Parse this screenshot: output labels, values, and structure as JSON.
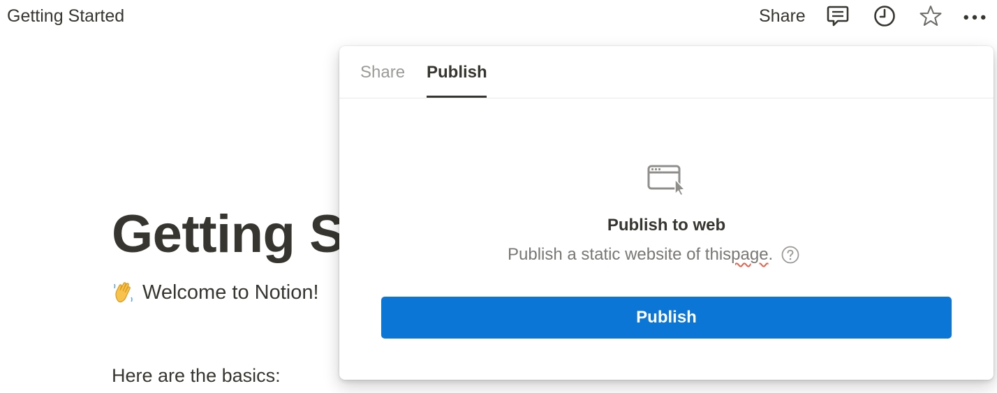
{
  "topbar": {
    "breadcrumb": "Getting Started",
    "share_label": "Share",
    "icons": [
      "comment-icon",
      "clock-icon",
      "star-icon",
      "more-icon"
    ]
  },
  "page": {
    "title": "Getting S",
    "welcome": "Welcome to Notion!",
    "welcome_icon": "waving-hand-emoji",
    "basics": "Here are the basics:"
  },
  "popover": {
    "tabs": [
      {
        "label": "Share",
        "active": false
      },
      {
        "label": "Publish",
        "active": true
      }
    ],
    "icon": "browser-window-cursor-icon",
    "heading": "Publish to web",
    "description_prefix": "Publish a static website of this",
    "description_misspelled": "page",
    "description_suffix": ".",
    "button_label": "Publish"
  },
  "colors": {
    "text": "#37352f",
    "muted": "#787774",
    "tab_inactive": "#9b9a97",
    "accent": "#0b76d6",
    "spellcheck": "#e2624b"
  }
}
